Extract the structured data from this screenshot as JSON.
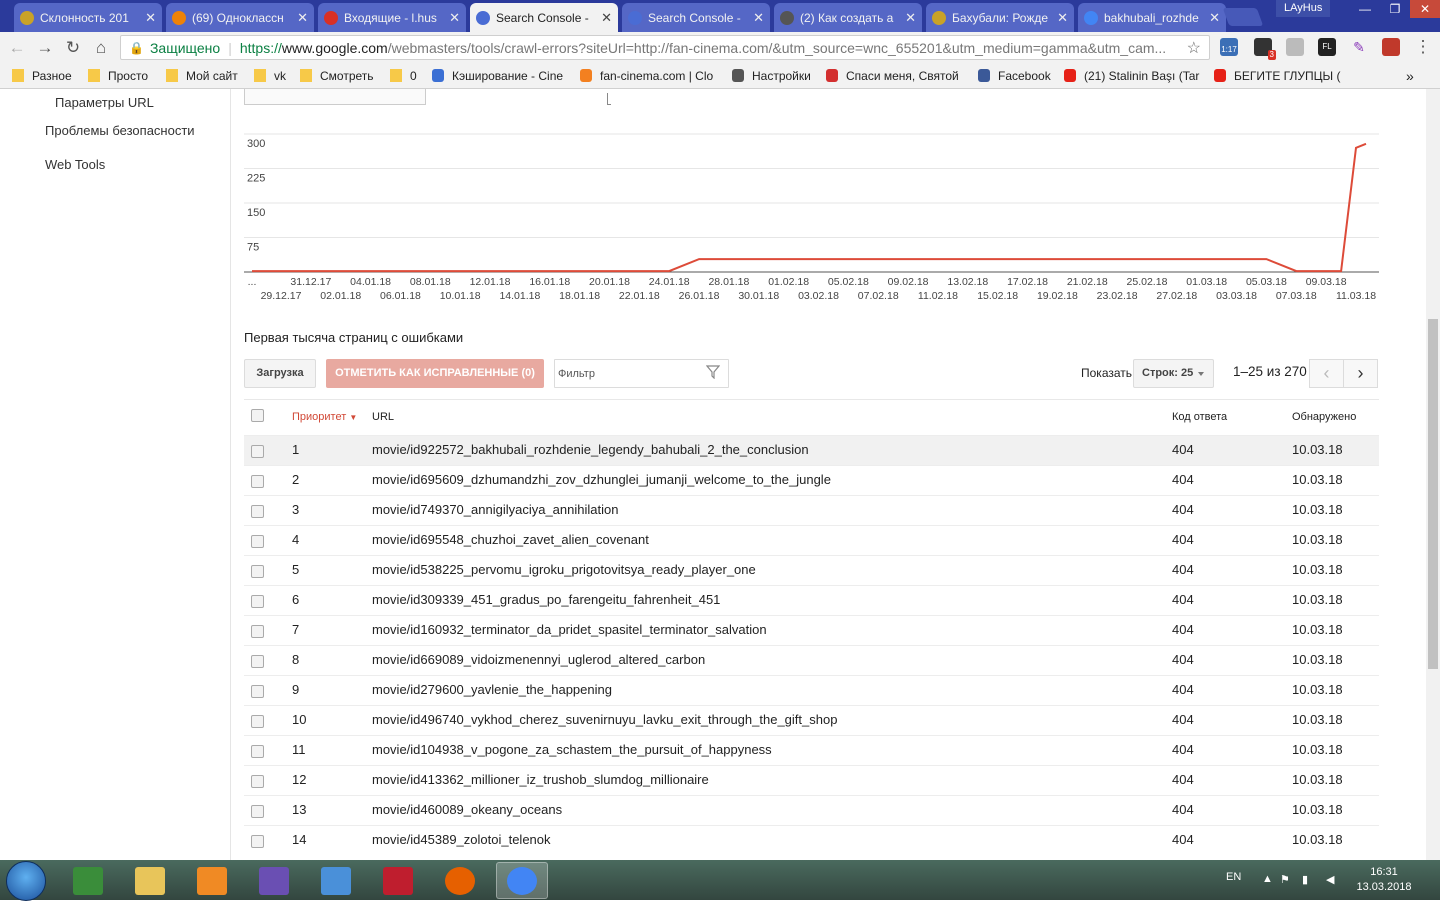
{
  "browser": {
    "tabs": [
      {
        "title": "Склонность 201",
        "favicon_color": "#c9a227"
      },
      {
        "title": "(69) Одноклассн",
        "favicon_color": "#ee8208"
      },
      {
        "title": "Входящие - l.hus",
        "favicon_color": "#d93025"
      },
      {
        "title": "Search Console -",
        "favicon_color": "#4a6cd4",
        "active": true
      },
      {
        "title": "Search Console -",
        "favicon_color": "#4a6cd4"
      },
      {
        "title": "(2) Как создать а",
        "favicon_color": "#555555"
      },
      {
        "title": "Бахубали: Рожде",
        "favicon_color": "#c9a227"
      },
      {
        "title": "bakhubali_rozhde",
        "favicon_color": "#4285f4"
      }
    ],
    "profile_name": "LAyHus",
    "address": {
      "security_label": "Защищено",
      "scheme": "https://",
      "host": "www.google.com",
      "path": "/webmasters/tools/crawl-errors?siteUrl=http://fan-cinema.com/&utm_source=wnc_655201&utm_medium=gamma&utm_cam..."
    },
    "extension_badges": {
      "counter": "1:17",
      "notif": "3"
    },
    "bookmarks": [
      {
        "label": "Разное",
        "icon": "folder-icon"
      },
      {
        "label": "Просто",
        "icon": "folder-icon"
      },
      {
        "label": "Мой сайт",
        "icon": "folder-icon"
      },
      {
        "label": "vk",
        "icon": "folder-icon"
      },
      {
        "label": "Смотреть",
        "icon": "folder-icon"
      },
      {
        "label": "0",
        "icon": "folder-icon"
      },
      {
        "label": "Кэширование - Cine",
        "icon": "database-icon"
      },
      {
        "label": "fan-cinema.com | Clo",
        "icon": "cloudflare-icon"
      },
      {
        "label": "Настройки",
        "icon": "gear-icon"
      },
      {
        "label": "Спаси меня, Святой",
        "icon": "z-icon"
      },
      {
        "label": "Facebook",
        "icon": "facebook-icon"
      },
      {
        "label": "(21) Stalinin Başı (Tar",
        "icon": "youtube-icon"
      },
      {
        "label": "БЕГИТЕ ГЛУПЦЫ (",
        "icon": "youtube-icon"
      }
    ],
    "more_bookmarks": "»"
  },
  "sidebar": {
    "items": [
      {
        "label": "Параметры URL"
      },
      {
        "label": "Проблемы безопасности"
      },
      {
        "label": "Web Tools"
      }
    ]
  },
  "chart_data": {
    "type": "line",
    "ylim": [
      0,
      300
    ],
    "y_ticks": [
      "300",
      "225",
      "150",
      "75"
    ],
    "x_ticks_top": [
      "...",
      "31.12.17",
      "04.01.18",
      "08.01.18",
      "12.01.18",
      "16.01.18",
      "20.01.18",
      "24.01.18",
      "28.01.18",
      "01.02.18",
      "05.02.18",
      "09.02.18",
      "13.02.18",
      "17.02.18",
      "21.02.18",
      "25.02.18",
      "01.03.18",
      "05.03.18",
      "09.03.18"
    ],
    "x_ticks_bottom": [
      "29.12.17",
      "02.01.18",
      "06.01.18",
      "10.01.18",
      "14.01.18",
      "18.01.18",
      "22.01.18",
      "26.01.18",
      "30.01.18",
      "03.02.18",
      "07.02.18",
      "11.02.18",
      "15.02.18",
      "19.02.18",
      "23.02.18",
      "27.02.18",
      "03.03.18",
      "07.03.18",
      "11.03.18"
    ],
    "series": [
      {
        "color": "#dd4b39",
        "points": [
          [
            "28.12.17",
            2
          ],
          [
            "31.12.17",
            2
          ],
          [
            "08.01.18",
            2
          ],
          [
            "16.01.18",
            2
          ],
          [
            "24.01.18",
            2
          ],
          [
            "26.01.18",
            28
          ],
          [
            "01.02.18",
            28
          ],
          [
            "09.02.18",
            28
          ],
          [
            "17.02.18",
            28
          ],
          [
            "25.02.18",
            28
          ],
          [
            "03.03.18",
            28
          ],
          [
            "05.03.18",
            28
          ],
          [
            "07.03.18",
            2
          ],
          [
            "08.03.18",
            2
          ],
          [
            "10.03.18",
            2
          ],
          [
            "11.03.18",
            270
          ]
        ]
      }
    ]
  },
  "section_title": "Первая тысяча страниц с ошибками",
  "controls": {
    "load_button": "Загрузка",
    "mark_fixed_button": "ОТМЕТИТЬ КАК ИСПРАВЛЕННЫЕ (0)",
    "filter_placeholder": "Фильтр",
    "show_label": "Показать",
    "rows_select": "Строк: 25",
    "range_text": "1–25 из 270"
  },
  "table": {
    "columns": {
      "priority": "Приоритет",
      "url": "URL",
      "code": "Код ответа",
      "detected": "Обнаружено"
    },
    "rows": [
      {
        "priority": "1",
        "url": "movie/id922572_bakhubali_rozhdenie_legendy_bahubali_2_the_conclusion",
        "code": "404",
        "detected": "10.03.18"
      },
      {
        "priority": "2",
        "url": "movie/id695609_dzhumandzhi_zov_dzhunglei_jumanji_welcome_to_the_jungle",
        "code": "404",
        "detected": "10.03.18"
      },
      {
        "priority": "3",
        "url": "movie/id749370_annigilyaciya_annihilation",
        "code": "404",
        "detected": "10.03.18"
      },
      {
        "priority": "4",
        "url": "movie/id695548_chuzhoi_zavet_alien_covenant",
        "code": "404",
        "detected": "10.03.18"
      },
      {
        "priority": "5",
        "url": "movie/id538225_pervomu_igroku_prigotovitsya_ready_player_one",
        "code": "404",
        "detected": "10.03.18"
      },
      {
        "priority": "6",
        "url": "movie/id309339_451_gradus_po_farengeitu_fahrenheit_451",
        "code": "404",
        "detected": "10.03.18"
      },
      {
        "priority": "7",
        "url": "movie/id160932_terminator_da_pridet_spasitel_terminator_salvation",
        "code": "404",
        "detected": "10.03.18"
      },
      {
        "priority": "8",
        "url": "movie/id669089_vidoizmenennyi_uglerod_altered_carbon",
        "code": "404",
        "detected": "10.03.18"
      },
      {
        "priority": "9",
        "url": "movie/id279600_yavlenie_the_happening",
        "code": "404",
        "detected": "10.03.18"
      },
      {
        "priority": "10",
        "url": "movie/id496740_vykhod_cherez_suvenirnuyu_lavku_exit_through_the_gift_shop",
        "code": "404",
        "detected": "10.03.18"
      },
      {
        "priority": "11",
        "url": "movie/id104938_v_pogone_za_schastem_the_pursuit_of_happyness",
        "code": "404",
        "detected": "10.03.18"
      },
      {
        "priority": "12",
        "url": "movie/id413362_millioner_iz_trushob_slumdog_millionaire",
        "code": "404",
        "detected": "10.03.18"
      },
      {
        "priority": "13",
        "url": "movie/id460089_okeany_oceans",
        "code": "404",
        "detected": "10.03.18"
      },
      {
        "priority": "14",
        "url": "movie/id45389_zolotoi_telenok",
        "code": "404",
        "detected": "10.03.18"
      }
    ]
  },
  "taskbar": {
    "apps": [
      {
        "name": "task-manager-icon",
        "color": "#3a8d3a"
      },
      {
        "name": "file-explorer-icon",
        "color": "#e8c55a"
      },
      {
        "name": "media-player-icon",
        "color": "#f08a24"
      },
      {
        "name": "visual-studio-icon",
        "color": "#6a4fb3"
      },
      {
        "name": "remote-desktop-icon",
        "color": "#4a90d9"
      },
      {
        "name": "filezilla-icon",
        "color": "#bf1e2e"
      },
      {
        "name": "firefox-icon",
        "color": "#e66000"
      },
      {
        "name": "chrome-icon",
        "color": "#4285f4",
        "active": true
      }
    ],
    "language": "EN",
    "time": "16:31",
    "date": "13.03.2018"
  }
}
